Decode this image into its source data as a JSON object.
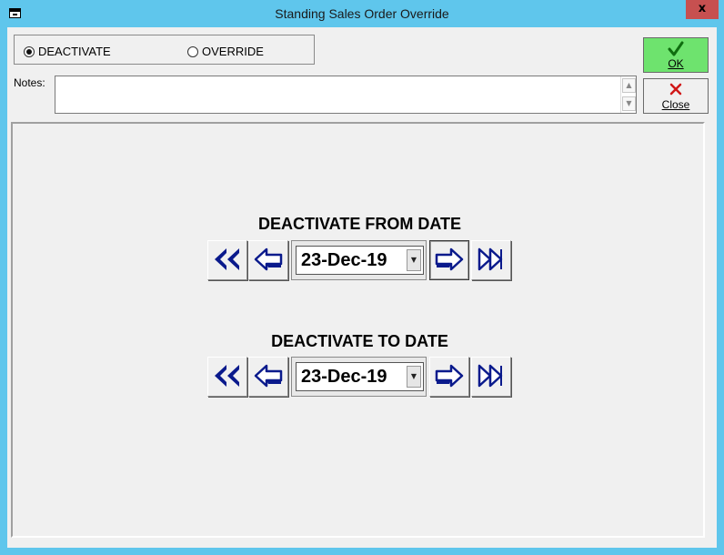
{
  "window": {
    "title": "Standing Sales Order Override",
    "close_glyph": "x"
  },
  "mode": {
    "options": [
      {
        "label": "DEACTIVATE",
        "selected": true
      },
      {
        "label": "OVERRIDE",
        "selected": false
      }
    ]
  },
  "notes": {
    "label": "Notes:",
    "value": ""
  },
  "buttons": {
    "ok_label": "OK",
    "ok_icon": "checkmark-icon",
    "close_label": "Close",
    "close_icon": "red-x-icon"
  },
  "from": {
    "title": "DEACTIVATE FROM DATE",
    "date": "23-Dec-19"
  },
  "to": {
    "title": "DEACTIVATE TO DATE",
    "date": "23-Dec-19"
  },
  "colors": {
    "titlebar": "#5fc6ec",
    "ok_button": "#6ee36e",
    "arrow_blue": "#0a1a8c",
    "arrow_fill": "#ffffff"
  }
}
